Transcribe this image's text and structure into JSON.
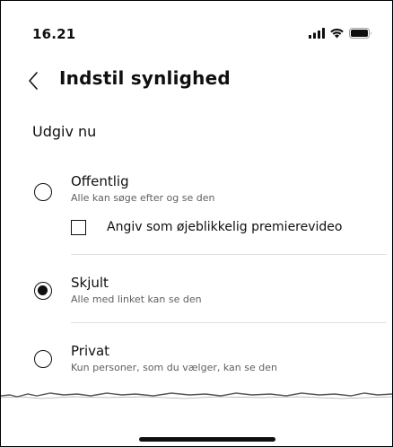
{
  "status_bar": {
    "time": "16.21",
    "icons": [
      "signal-icon",
      "wifi-icon",
      "battery-icon"
    ]
  },
  "header": {
    "back_icon": "chevron-left-icon",
    "title": "Indstil synlighed"
  },
  "section": {
    "title": "Udgiv nu"
  },
  "options": [
    {
      "title": "Offentlig",
      "subtitle": "Alle kan søge efter og se den",
      "selected": false,
      "checkbox": {
        "label": "Angiv som øjeblikkelig premierevideo",
        "checked": false
      }
    },
    {
      "title": "Skjult",
      "subtitle": "Alle med linket kan se den",
      "selected": true
    },
    {
      "title": "Privat",
      "subtitle": "Kun personer, som du vælger, kan se den",
      "selected": false
    }
  ],
  "colors": {
    "text": "#0f0f0f",
    "secondary_text": "#606060",
    "divider": "#e2e2e2",
    "background": "#ffffff"
  }
}
